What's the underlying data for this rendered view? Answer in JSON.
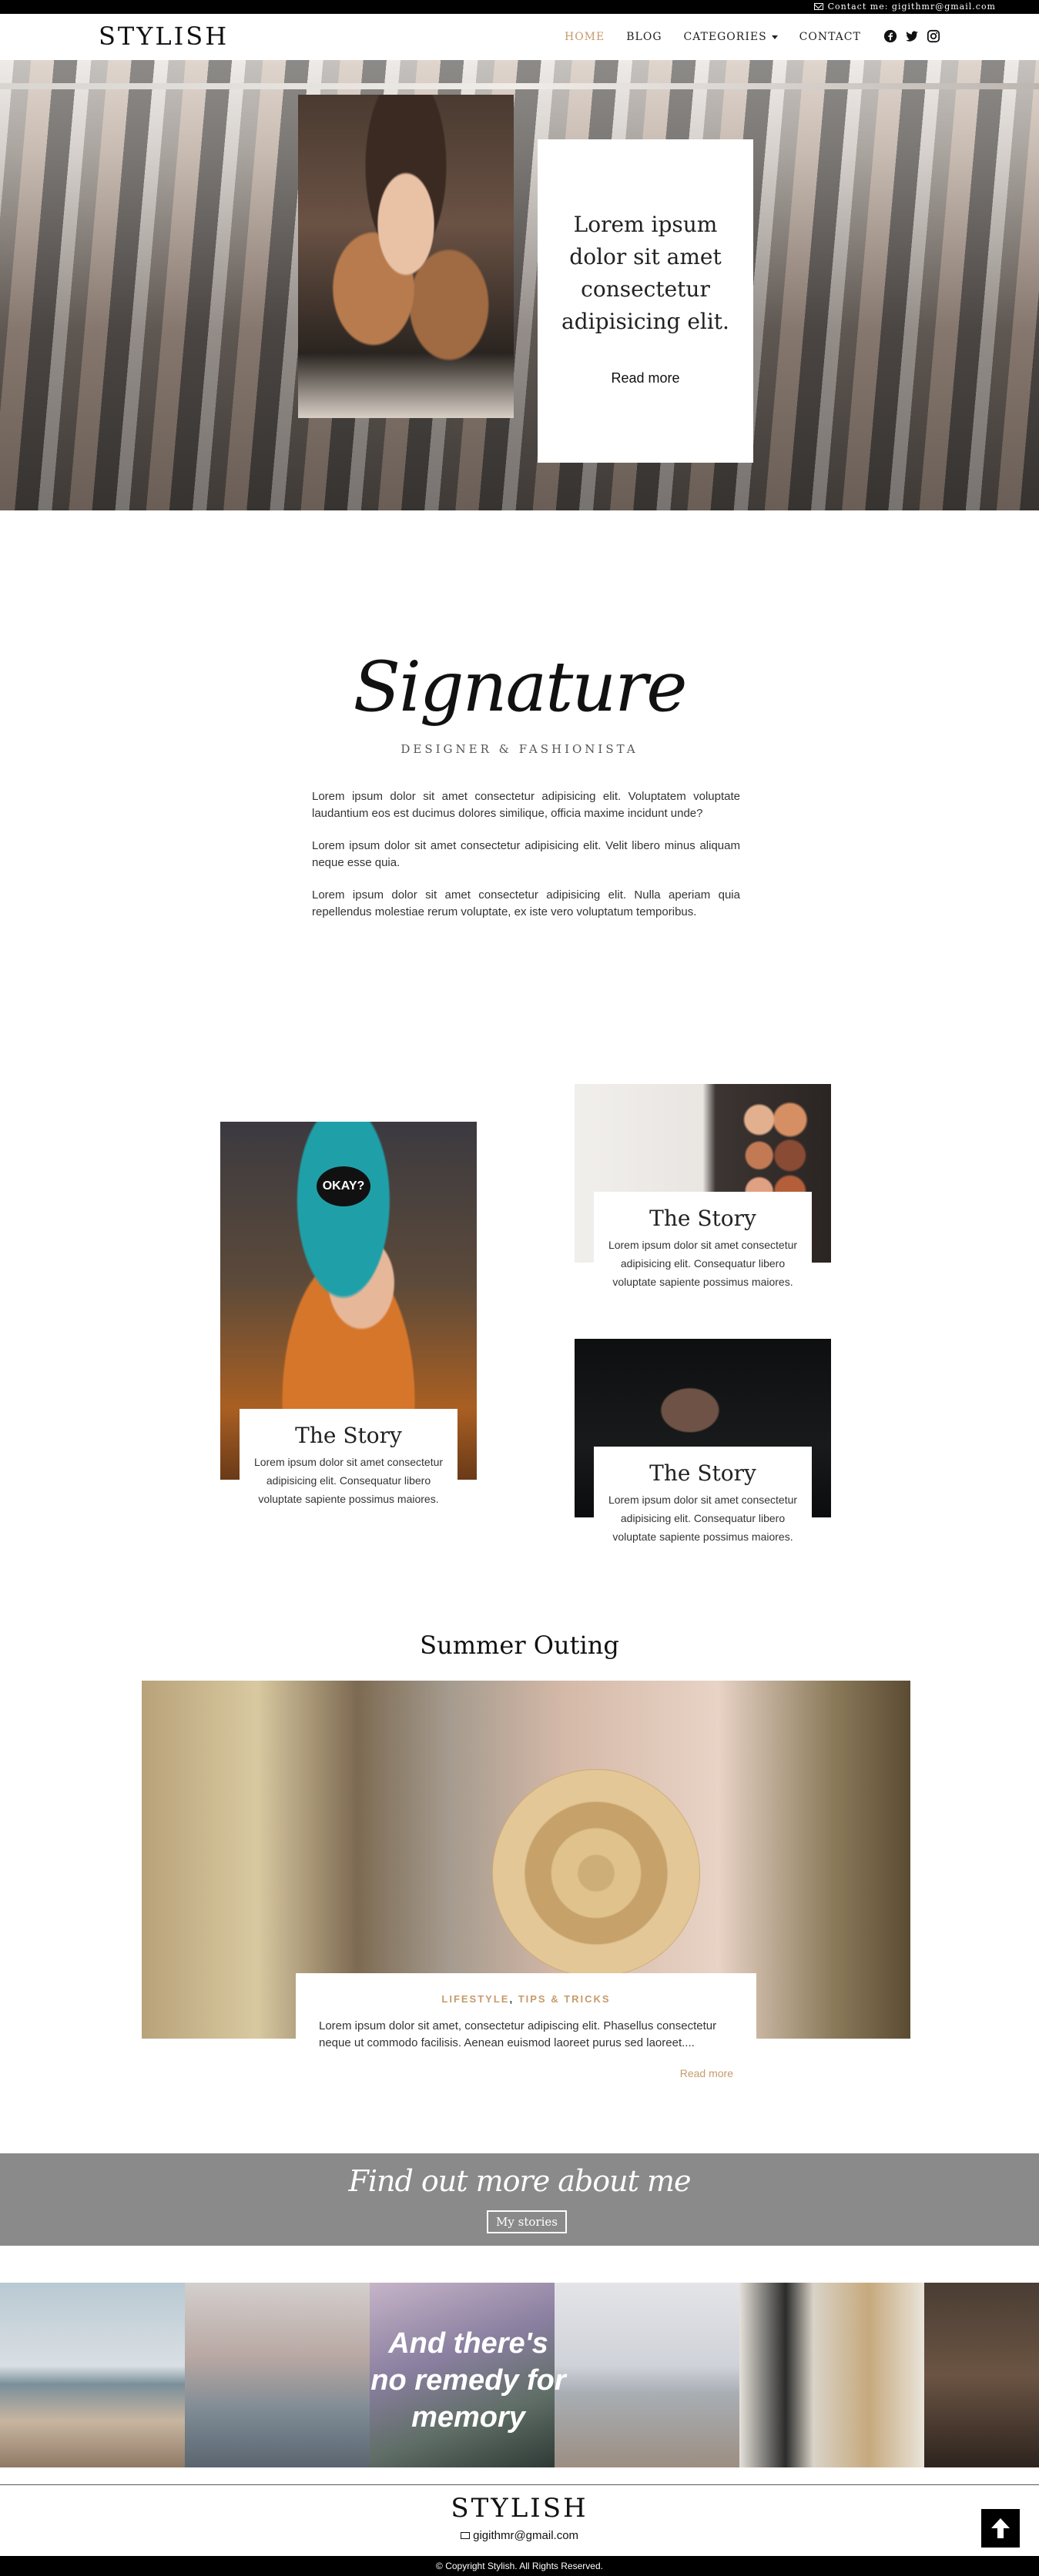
{
  "topbar": {
    "contact": "Contact me: gigithmr@gmail.com"
  },
  "nav": {
    "brand": "STYLISH",
    "items": [
      {
        "label": "HOME"
      },
      {
        "label": "BLOG"
      },
      {
        "label": "CATEGORIES"
      },
      {
        "label": "CONTACT"
      }
    ],
    "social": [
      "facebook-icon",
      "twitter-icon",
      "instagram-icon"
    ]
  },
  "hero": {
    "title": "Lorem ipsum dolor sit amet consectetur adipisicing elit.",
    "read_more": "Read more"
  },
  "about": {
    "signature": "Signature",
    "subtitle": "DESIGNER & FASHIONISTA",
    "paragraphs": [
      "Lorem ipsum dolor sit amet consectetur adipisicing elit. Voluptatem voluptate laudantium eos est ducimus dolores similique, officia maxime incidunt unde?",
      "Lorem ipsum dolor sit amet consectetur adipisicing elit. Velit libero minus aliquam neque esse quia.",
      "Lorem ipsum dolor sit amet consectetur adipisicing elit. Nulla aperiam quia repellendus molestiae rerum voluptate, ex iste vero voluptatum temporibus."
    ]
  },
  "stories": [
    {
      "title": "The Story",
      "text": "Lorem ipsum dolor sit amet consectetur adipisicing elit. Consequatur libero voluptate sapiente possimus maiores.",
      "hat_text": "OKAY?"
    },
    {
      "title": "The Story",
      "text": "Lorem ipsum dolor sit amet consectetur adipisicing elit. Consequatur libero voluptate sapiente possimus maiores."
    },
    {
      "title": "The Story",
      "text": "Lorem ipsum dolor sit amet consectetur adipisicing elit. Consequatur libero voluptate sapiente possimus maiores."
    }
  ],
  "outing": {
    "title": "Summer Outing",
    "cat1": "LIFESTYLE",
    "sep": ", ",
    "cat2": "TIPS & TRICKS",
    "text": "Lorem ipsum dolor sit amet, consectetur adipiscing elit. Phasellus consectetur neque ut commodo facilisis. Aenean euismod laoreet purus sed laoreet....",
    "read_more": "Read more"
  },
  "band": {
    "title": "Find out more about me",
    "button": "My stories"
  },
  "gallery": {
    "quote": "And there's no remedy for memory"
  },
  "footer": {
    "brand": "STYLISH",
    "email": "gigithmr@gmail.com",
    "copyright": "© Copyright Stylish. All Rights Reserved."
  },
  "colors": {
    "accent": "#c79a6b",
    "band": "#8a8a8a",
    "black": "#000000"
  }
}
